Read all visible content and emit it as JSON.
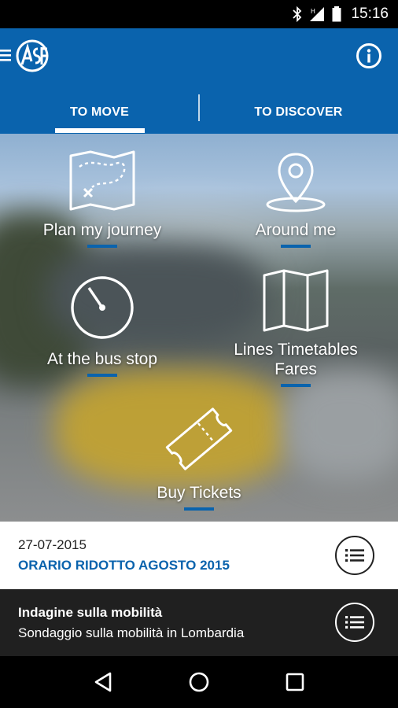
{
  "status_bar": {
    "time": "15:16",
    "icons": [
      "bluetooth-icon",
      "signal-icon",
      "battery-icon"
    ]
  },
  "app_bar": {
    "logo_text": "ASF",
    "tabs": [
      {
        "label": "TO MOVE",
        "active": true
      },
      {
        "label": "TO DISCOVER",
        "active": false
      }
    ]
  },
  "actions": {
    "plan": "Plan my journey",
    "around": "Around me",
    "bus_stop": "At the bus stop",
    "lines": "Lines Timetables\nFares",
    "tickets": "Buy Tickets"
  },
  "news": {
    "date": "27-07-2015",
    "title": "ORARIO RIDOTTO AGOSTO 2015"
  },
  "survey": {
    "title": "Indagine sulla mobilità",
    "subtitle": "Sondaggio sulla mobilità in Lombardia"
  },
  "colors": {
    "brand": "#0a63ad",
    "dark_row": "#202020"
  }
}
